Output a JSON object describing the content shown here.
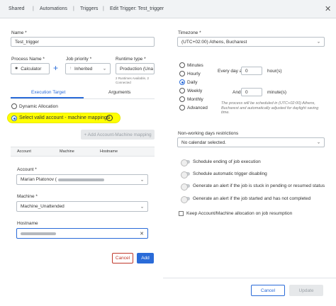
{
  "breadcrumbs": [
    "Shared",
    "Automations",
    "Triggers",
    "Edit Trigger: Test_trigger"
  ],
  "left": {
    "name_label": "Name *",
    "name_value": "Test_trigger",
    "process_label": "Process Name *",
    "process_value": "Calculator",
    "priority_label": "Job priority *",
    "priority_value": "Inherited",
    "runtime_label": "Runtime type *",
    "runtime_value": "Production (Una",
    "runtime_hint": "2 Runtimes Available, 2 Connected",
    "tabs": [
      "Execution Target",
      "Arguments"
    ],
    "radio_dynamic": "Dynamic Allocation",
    "radio_select": "Select valid account - machine mappings",
    "add_mapping_label": "+ Add Account-Machine mapping",
    "table_headers": [
      "Account",
      "Machine",
      "Hostname"
    ],
    "account_label": "Account *",
    "account_value": "Marian Platonov (",
    "machine_label": "Machine *",
    "machine_value": "Machine_Unattended",
    "hostname_label": "Hostname",
    "hostname_value": "",
    "cancel_label": "Cancel",
    "add_label": "Add"
  },
  "right": {
    "timezone_label": "Timezone *",
    "timezone_value": "(UTC+02:00) Athens, Bucharest",
    "freq": [
      "Minutes",
      "Hourly",
      "Daily",
      "Weekly",
      "Monthly",
      "Advanced"
    ],
    "every_day_at": "Every day at",
    "hours_value": "0",
    "hours_label": "hour(s)",
    "and_label": "And",
    "minutes_value": "0",
    "minutes_label": "minute(s)",
    "schedule_note": "The process will be scheduled in (UTC+02:00) Athens, Bucharest and automatically adjusted for daylight saving time.",
    "nonworking_label": "Non-working days restrictions",
    "nonworking_value": "No calendar selected.",
    "toggles": [
      "Schedule ending of job execution",
      "Schedule automatic trigger disabling",
      "Generate an alert if the job is stuck in pending or resumed status",
      "Generate an alert if the job started and has not completed"
    ],
    "keep_label": "Keep Account/Machine allocation on job resumption",
    "cancel_label": "Cancel",
    "update_label": "Update"
  },
  "colors": {
    "accent": "#2a6bd8",
    "highlight": "#ffff00",
    "danger": "#c0392b"
  }
}
